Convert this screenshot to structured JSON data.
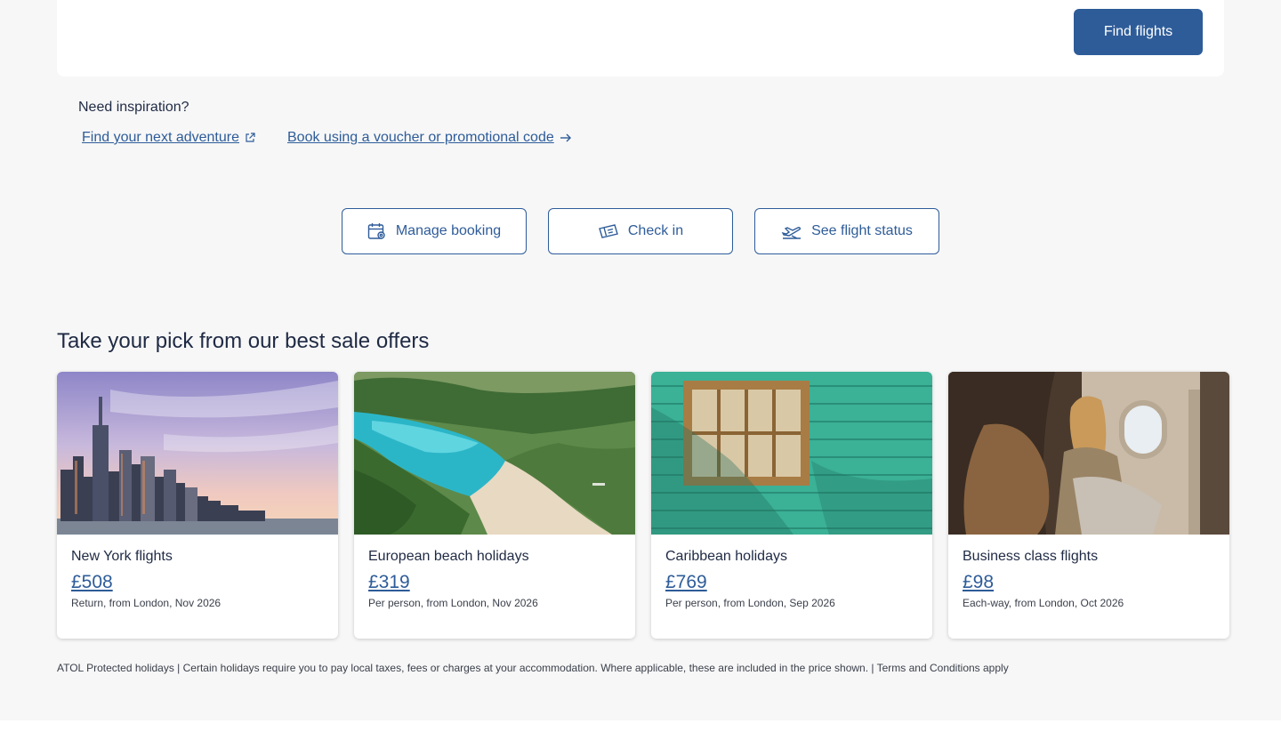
{
  "search": {
    "find_button": "Find flights"
  },
  "inspiration": {
    "title": "Need inspiration?",
    "links": [
      {
        "label": "Find your next adventure",
        "icon": "external-link-icon"
      },
      {
        "label": "Book using a voucher or promotional code",
        "icon": "arrow-right-icon"
      }
    ]
  },
  "quick_actions": [
    {
      "label": "Manage booking",
      "icon": "calendar-gear-icon"
    },
    {
      "label": "Check in",
      "icon": "ticket-icon"
    },
    {
      "label": "See flight status",
      "icon": "plane-takeoff-icon"
    }
  ],
  "offers": {
    "title": "Take your pick from our best sale offers",
    "cards": [
      {
        "name": "New York flights",
        "price": "£508",
        "meta": "Return, from London, Nov 2026",
        "image": "new-york-skyline"
      },
      {
        "name": "European beach holidays",
        "price": "£319",
        "meta": "Per person, from London, Nov 2026",
        "image": "beach-cove"
      },
      {
        "name": "Caribbean holidays",
        "price": "£769",
        "meta": "Per person, from London, Sep 2026",
        "image": "turquoise-house-window"
      },
      {
        "name": "Business class flights",
        "price": "£98",
        "meta": "Each-way, from London, Oct 2026",
        "image": "business-class-cabin"
      }
    ]
  },
  "disclaimer": "ATOL Protected holidays | Certain holidays require you to pay local taxes, fees or charges at your accommodation. Where applicable, these are included in the price shown. | Terms and Conditions apply",
  "colors": {
    "accent": "#2e5c99",
    "text": "#1f2a44",
    "background": "#f7f7f7"
  }
}
